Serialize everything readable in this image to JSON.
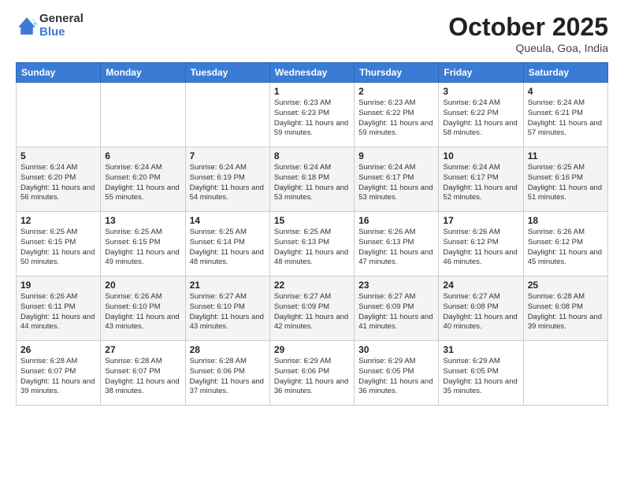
{
  "header": {
    "logo_general": "General",
    "logo_blue": "Blue",
    "month_title": "October 2025",
    "location": "Queula, Goa, India"
  },
  "columns": [
    "Sunday",
    "Monday",
    "Tuesday",
    "Wednesday",
    "Thursday",
    "Friday",
    "Saturday"
  ],
  "weeks": [
    [
      {
        "day": "",
        "sunrise": "",
        "sunset": "",
        "daylight": ""
      },
      {
        "day": "",
        "sunrise": "",
        "sunset": "",
        "daylight": ""
      },
      {
        "day": "",
        "sunrise": "",
        "sunset": "",
        "daylight": ""
      },
      {
        "day": "1",
        "sunrise": "Sunrise: 6:23 AM",
        "sunset": "Sunset: 6:23 PM",
        "daylight": "Daylight: 11 hours and 59 minutes."
      },
      {
        "day": "2",
        "sunrise": "Sunrise: 6:23 AM",
        "sunset": "Sunset: 6:22 PM",
        "daylight": "Daylight: 11 hours and 59 minutes."
      },
      {
        "day": "3",
        "sunrise": "Sunrise: 6:24 AM",
        "sunset": "Sunset: 6:22 PM",
        "daylight": "Daylight: 11 hours and 58 minutes."
      },
      {
        "day": "4",
        "sunrise": "Sunrise: 6:24 AM",
        "sunset": "Sunset: 6:21 PM",
        "daylight": "Daylight: 11 hours and 57 minutes."
      }
    ],
    [
      {
        "day": "5",
        "sunrise": "Sunrise: 6:24 AM",
        "sunset": "Sunset: 6:20 PM",
        "daylight": "Daylight: 11 hours and 56 minutes."
      },
      {
        "day": "6",
        "sunrise": "Sunrise: 6:24 AM",
        "sunset": "Sunset: 6:20 PM",
        "daylight": "Daylight: 11 hours and 55 minutes."
      },
      {
        "day": "7",
        "sunrise": "Sunrise: 6:24 AM",
        "sunset": "Sunset: 6:19 PM",
        "daylight": "Daylight: 11 hours and 54 minutes."
      },
      {
        "day": "8",
        "sunrise": "Sunrise: 6:24 AM",
        "sunset": "Sunset: 6:18 PM",
        "daylight": "Daylight: 11 hours and 53 minutes."
      },
      {
        "day": "9",
        "sunrise": "Sunrise: 6:24 AM",
        "sunset": "Sunset: 6:17 PM",
        "daylight": "Daylight: 11 hours and 53 minutes."
      },
      {
        "day": "10",
        "sunrise": "Sunrise: 6:24 AM",
        "sunset": "Sunset: 6:17 PM",
        "daylight": "Daylight: 11 hours and 52 minutes."
      },
      {
        "day": "11",
        "sunrise": "Sunrise: 6:25 AM",
        "sunset": "Sunset: 6:16 PM",
        "daylight": "Daylight: 11 hours and 51 minutes."
      }
    ],
    [
      {
        "day": "12",
        "sunrise": "Sunrise: 6:25 AM",
        "sunset": "Sunset: 6:15 PM",
        "daylight": "Daylight: 11 hours and 50 minutes."
      },
      {
        "day": "13",
        "sunrise": "Sunrise: 6:25 AM",
        "sunset": "Sunset: 6:15 PM",
        "daylight": "Daylight: 11 hours and 49 minutes."
      },
      {
        "day": "14",
        "sunrise": "Sunrise: 6:25 AM",
        "sunset": "Sunset: 6:14 PM",
        "daylight": "Daylight: 11 hours and 48 minutes."
      },
      {
        "day": "15",
        "sunrise": "Sunrise: 6:25 AM",
        "sunset": "Sunset: 6:13 PM",
        "daylight": "Daylight: 11 hours and 48 minutes."
      },
      {
        "day": "16",
        "sunrise": "Sunrise: 6:26 AM",
        "sunset": "Sunset: 6:13 PM",
        "daylight": "Daylight: 11 hours and 47 minutes."
      },
      {
        "day": "17",
        "sunrise": "Sunrise: 6:26 AM",
        "sunset": "Sunset: 6:12 PM",
        "daylight": "Daylight: 11 hours and 46 minutes."
      },
      {
        "day": "18",
        "sunrise": "Sunrise: 6:26 AM",
        "sunset": "Sunset: 6:12 PM",
        "daylight": "Daylight: 11 hours and 45 minutes."
      }
    ],
    [
      {
        "day": "19",
        "sunrise": "Sunrise: 6:26 AM",
        "sunset": "Sunset: 6:11 PM",
        "daylight": "Daylight: 11 hours and 44 minutes."
      },
      {
        "day": "20",
        "sunrise": "Sunrise: 6:26 AM",
        "sunset": "Sunset: 6:10 PM",
        "daylight": "Daylight: 11 hours and 43 minutes."
      },
      {
        "day": "21",
        "sunrise": "Sunrise: 6:27 AM",
        "sunset": "Sunset: 6:10 PM",
        "daylight": "Daylight: 11 hours and 43 minutes."
      },
      {
        "day": "22",
        "sunrise": "Sunrise: 6:27 AM",
        "sunset": "Sunset: 6:09 PM",
        "daylight": "Daylight: 11 hours and 42 minutes."
      },
      {
        "day": "23",
        "sunrise": "Sunrise: 6:27 AM",
        "sunset": "Sunset: 6:09 PM",
        "daylight": "Daylight: 11 hours and 41 minutes."
      },
      {
        "day": "24",
        "sunrise": "Sunrise: 6:27 AM",
        "sunset": "Sunset: 6:08 PM",
        "daylight": "Daylight: 11 hours and 40 minutes."
      },
      {
        "day": "25",
        "sunrise": "Sunrise: 6:28 AM",
        "sunset": "Sunset: 6:08 PM",
        "daylight": "Daylight: 11 hours and 39 minutes."
      }
    ],
    [
      {
        "day": "26",
        "sunrise": "Sunrise: 6:28 AM",
        "sunset": "Sunset: 6:07 PM",
        "daylight": "Daylight: 11 hours and 39 minutes."
      },
      {
        "day": "27",
        "sunrise": "Sunrise: 6:28 AM",
        "sunset": "Sunset: 6:07 PM",
        "daylight": "Daylight: 11 hours and 38 minutes."
      },
      {
        "day": "28",
        "sunrise": "Sunrise: 6:28 AM",
        "sunset": "Sunset: 6:06 PM",
        "daylight": "Daylight: 11 hours and 37 minutes."
      },
      {
        "day": "29",
        "sunrise": "Sunrise: 6:29 AM",
        "sunset": "Sunset: 6:06 PM",
        "daylight": "Daylight: 11 hours and 36 minutes."
      },
      {
        "day": "30",
        "sunrise": "Sunrise: 6:29 AM",
        "sunset": "Sunset: 6:05 PM",
        "daylight": "Daylight: 11 hours and 36 minutes."
      },
      {
        "day": "31",
        "sunrise": "Sunrise: 6:29 AM",
        "sunset": "Sunset: 6:05 PM",
        "daylight": "Daylight: 11 hours and 35 minutes."
      },
      {
        "day": "",
        "sunrise": "",
        "sunset": "",
        "daylight": ""
      }
    ]
  ]
}
